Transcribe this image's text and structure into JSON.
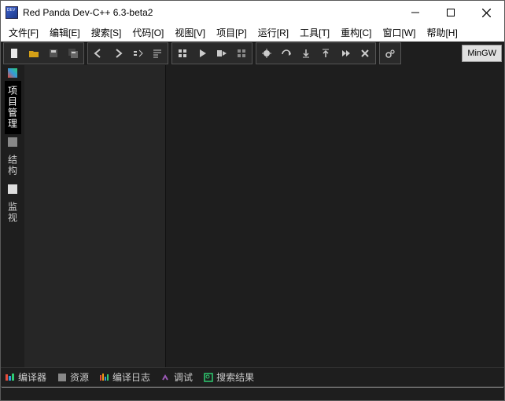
{
  "titlebar": {
    "title": "Red Panda Dev-C++ 6.3-beta2"
  },
  "menu": {
    "file": "文件[F]",
    "edit": "编辑[E]",
    "search": "搜索[S]",
    "code": "代码[O]",
    "view": "视图[V]",
    "project": "项目[P]",
    "run": "运行[R]",
    "tools": "工具[T]",
    "refactor": "重构[C]",
    "window": "窗口[W]",
    "help": "帮助[H]"
  },
  "toolbar": {
    "compiler_label": "MinGW"
  },
  "sidebar": {
    "tab_project": "项目管理",
    "tab_structure": "结构",
    "tab_watch": "监视"
  },
  "bottom_tabs": {
    "compiler": "编译器",
    "resources": "资源",
    "compilelog": "编译日志",
    "debug": "调试",
    "searchresults": "搜索结果"
  }
}
